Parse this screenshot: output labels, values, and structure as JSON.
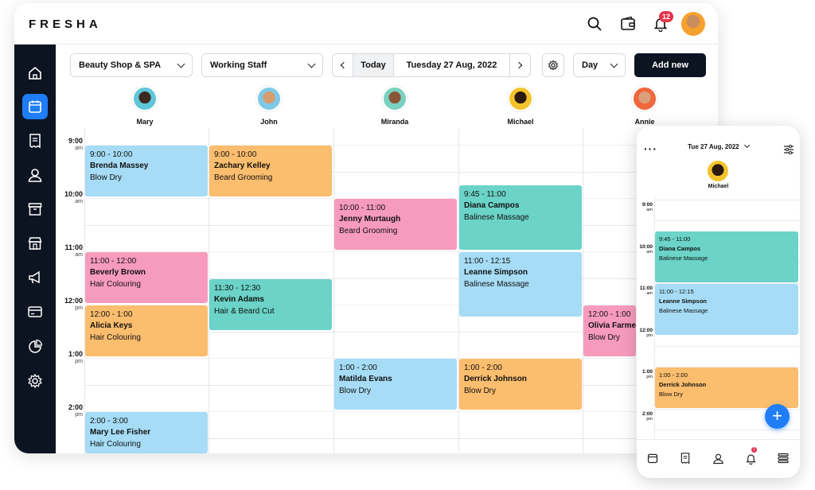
{
  "app": {
    "logo": "FRESHA",
    "notification_count": "12"
  },
  "sidebar": {
    "items": [
      "home-icon",
      "calendar-icon",
      "receipt-icon",
      "user-icon",
      "archive-icon",
      "store-icon",
      "megaphone-icon",
      "card-icon",
      "pie-chart-icon",
      "settings-icon"
    ],
    "active": "calendar-icon"
  },
  "toolbar": {
    "location": "Beauty Shop & SPA",
    "staff_filter": "Working Staff",
    "today_label": "Today",
    "date": "Tuesday 27 Aug, 2022",
    "view": "Day",
    "add_new": "Add new"
  },
  "staff": [
    {
      "name": "Mary",
      "color": "#3b2a20",
      "bg": "#5fc7d9"
    },
    {
      "name": "John",
      "color": "#d89b6e",
      "bg": "#7ec9e6"
    },
    {
      "name": "Miranda",
      "color": "#8a5638",
      "bg": "#7ad1c0"
    },
    {
      "name": "Michael",
      "color": "#2b1a12",
      "bg": "#f4c32c"
    },
    {
      "name": "Annie",
      "color": "#d9a07a",
      "bg": "#f0663d"
    }
  ],
  "times": [
    {
      "h": "9:00",
      "p": "am"
    },
    {
      "h": "10:00",
      "p": "am"
    },
    {
      "h": "11:00",
      "p": "am"
    },
    {
      "h": "12:00",
      "p": "pm"
    },
    {
      "h": "1:00",
      "p": "pm"
    },
    {
      "h": "2:00",
      "p": "pm"
    }
  ],
  "appointments": [
    {
      "time": "9:00 - 10:00",
      "client": "Brenda Massey",
      "service": "Blow Dry",
      "color": "#a6dcf5"
    },
    {
      "time": "9:00 - 10:00",
      "client": "Zachary Kelley",
      "service": "Beard Grooming",
      "color": "#fbbd6e"
    },
    {
      "time": "10:00 - 11:00",
      "client": "Jenny Murtaugh",
      "service": "Beard Grooming",
      "color": "#f79bbd"
    },
    {
      "time": "9:45 - 11:00",
      "client": "Diana Campos",
      "service": "Balinese Massage",
      "color": "#6bd3c8"
    },
    {
      "time": "11:00 - 12:00",
      "client": "Beverly Brown",
      "service": "Hair Colouring",
      "color": "#f79bbd"
    },
    {
      "time": "11:30 - 12:30",
      "client": "Kevin Adams",
      "service": "Hair & Beard Cut",
      "color": "#6bd3c8"
    },
    {
      "time": "11:00 - 12:15",
      "client": "Leanne Simpson",
      "service": "Balinese Massage",
      "color": "#a6dcf5"
    },
    {
      "time": "12:00 - 1:00",
      "client": "Alicia Keys",
      "service": "Hair Colouring",
      "color": "#fbbd6e"
    },
    {
      "time": "12:00 - 1:00",
      "client": "Olivia Farmer",
      "service": "Blow Dry",
      "color": "#f79bbd"
    },
    {
      "time": "1:00 - 2:00",
      "client": "Matilda Evans",
      "service": "Blow Dry",
      "color": "#a6dcf5"
    },
    {
      "time": "1:00 - 2:00",
      "client": "Derrick Johnson",
      "service": "Blow Dry",
      "color": "#fbbd6e"
    },
    {
      "time": "2:00 - 3:00",
      "client": "Mary Lee Fisher",
      "service": "Hair Colouring",
      "color": "#a6dcf5"
    }
  ],
  "mobile": {
    "date": "Tue 27 Aug, 2022",
    "staff_name": "Michael",
    "times": [
      {
        "h": "9:00",
        "p": "am"
      },
      {
        "h": "10:00",
        "p": "am"
      },
      {
        "h": "11:00",
        "p": "am"
      },
      {
        "h": "12:00",
        "p": "pm"
      },
      {
        "h": "1:00",
        "p": "pm"
      },
      {
        "h": "2:00",
        "p": "pm"
      }
    ],
    "appointments": [
      {
        "time": "9:45 - 11:00",
        "client": "Diana Campos",
        "service": "Balinese Massage",
        "color": "#6bd3c8"
      },
      {
        "time": "11:00 - 12:15",
        "client": "Leanne Simpson",
        "service": "Balinese Massage",
        "color": "#a6dcf5"
      },
      {
        "time": "1:00 - 2:00",
        "client": "Derrick Johnson",
        "service": "Blow Dry",
        "color": "#fbbd6e"
      }
    ],
    "fab": "+",
    "notification_count": "1"
  }
}
